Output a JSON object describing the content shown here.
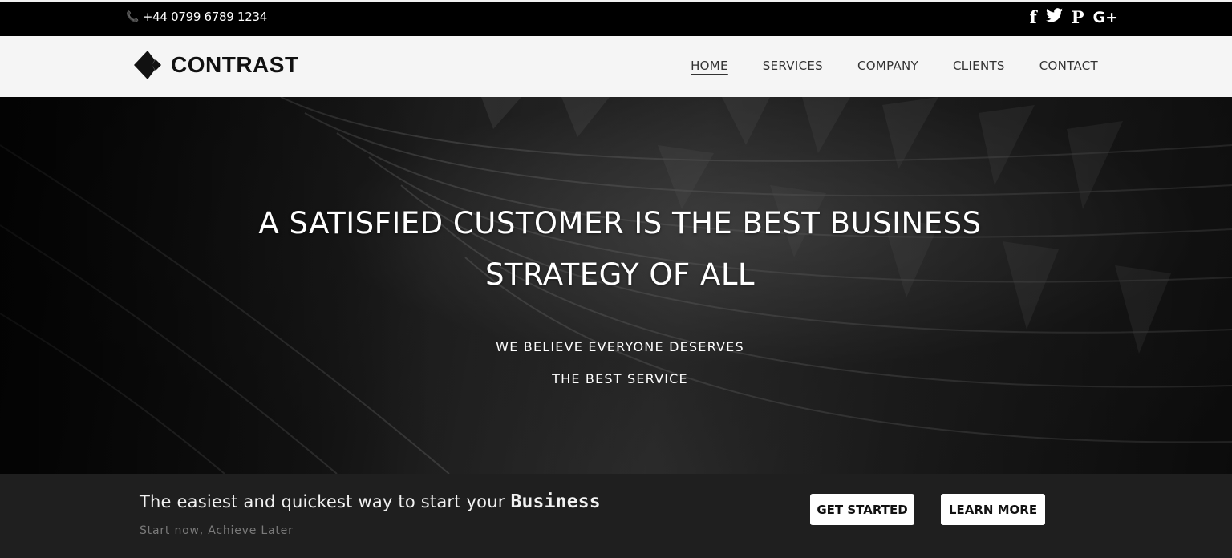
{
  "topbar": {
    "phone_icon": "phone-icon",
    "phone": "+44 0799 6789 1234",
    "social": [
      {
        "name": "facebook-icon",
        "glyph": "f"
      },
      {
        "name": "twitter-icon",
        "glyph": "🐦"
      },
      {
        "name": "pinterest-icon",
        "glyph": "P"
      },
      {
        "name": "google-plus-icon",
        "glyph": "G+"
      }
    ]
  },
  "navbar": {
    "logo_text": "CONTRAST",
    "links": [
      {
        "label": "HOME",
        "active": true
      },
      {
        "label": "SERVICES",
        "active": false
      },
      {
        "label": "COMPANY",
        "active": false
      },
      {
        "label": "CLIENTS",
        "active": false
      },
      {
        "label": "CONTACT",
        "active": false
      }
    ]
  },
  "hero": {
    "title_line1": "A SATISFIED CUSTOMER IS THE BEST BUSINESS",
    "title_line2": "STRATEGY OF ALL",
    "sub_line1": "WE BELIEVE EVERYONE DESERVES",
    "sub_line2": "THE BEST SERVICE"
  },
  "cta": {
    "text": "The easiest and quickest way to start your",
    "text_strong": "Business",
    "subtext": "Start now, Achieve Later",
    "get_started": "GET STARTED",
    "learn_more": "LEARN MORE"
  },
  "colors": {
    "topbar_bg": "#000000",
    "nav_bg": "#f5f5f5",
    "cta_bg": "#1f1f1f",
    "button_bg": "#ffffff"
  }
}
